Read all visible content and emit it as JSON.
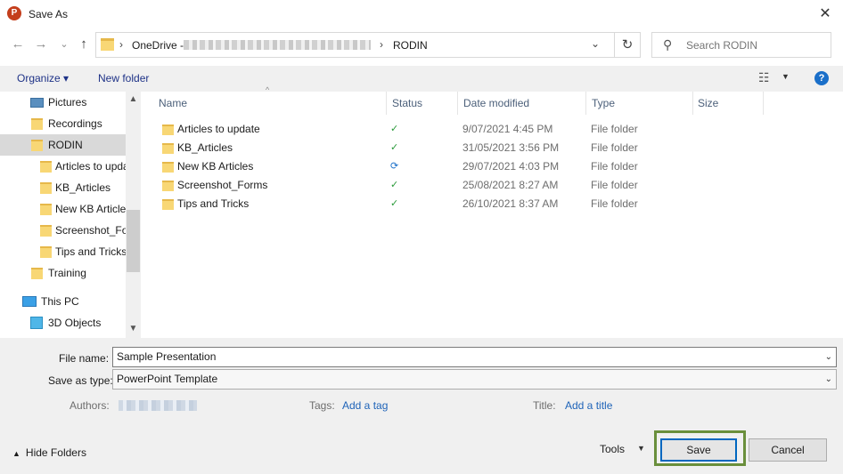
{
  "window": {
    "title": "Save As",
    "app_icon": "P"
  },
  "nav": {
    "back_glyph": "←",
    "forward_glyph": "→",
    "recent_glyph": "⌄",
    "up_glyph": "↑",
    "path": [
      "OneDrive -",
      "RODIN"
    ],
    "refresh_glyph": "↻",
    "search_placeholder": "Search RODIN"
  },
  "toolbar": {
    "organize": "Organize ▾",
    "new_folder": "New folder",
    "help": "?"
  },
  "tree": [
    {
      "label": "Pictures",
      "icon": "pictures-icon",
      "indent": 1
    },
    {
      "label": "Recordings",
      "icon": "folder-icon",
      "indent": 1
    },
    {
      "label": "RODIN",
      "icon": "folder-icon",
      "indent": 1,
      "selected": true
    },
    {
      "label": "Articles to update",
      "icon": "folder-icon",
      "indent": 2
    },
    {
      "label": "KB_Articles",
      "icon": "folder-icon",
      "indent": 2
    },
    {
      "label": "New KB Articles",
      "icon": "folder-icon",
      "indent": 2
    },
    {
      "label": "Screenshot_Forms",
      "icon": "folder-icon",
      "indent": 2
    },
    {
      "label": "Tips and Tricks",
      "icon": "folder-icon",
      "indent": 2
    },
    {
      "label": "Training",
      "icon": "folder-icon",
      "indent": 1
    },
    {
      "label": "This PC",
      "icon": "pc-icon",
      "indent": 0
    },
    {
      "label": "3D Objects",
      "icon": "cube-icon",
      "indent": 1
    }
  ],
  "columns": [
    "Name",
    "Status",
    "Date modified",
    "Type",
    "Size"
  ],
  "files": [
    {
      "name": "Articles to update",
      "status": "synced",
      "date": "9/07/2021 4:45 PM",
      "type": "File folder"
    },
    {
      "name": "KB_Articles",
      "status": "synced",
      "date": "31/05/2021 3:56 PM",
      "type": "File folder"
    },
    {
      "name": "New KB Articles",
      "status": "syncing",
      "date": "29/07/2021 4:03 PM",
      "type": "File folder"
    },
    {
      "name": "Screenshot_Forms",
      "status": "synced",
      "date": "25/08/2021 8:27 AM",
      "type": "File folder"
    },
    {
      "name": "Tips and Tricks",
      "status": "synced",
      "date": "26/10/2021 8:37 AM",
      "type": "File folder"
    }
  ],
  "form": {
    "file_name_label": "File name:",
    "file_name_value": "Sample Presentation",
    "save_type_label": "Save as type:",
    "save_type_value": "PowerPoint Template",
    "authors_label": "Authors:",
    "tags_label": "Tags:",
    "tags_link": "Add a tag",
    "title_label": "Title:",
    "title_link": "Add a title"
  },
  "footer": {
    "hide_folders": "Hide Folders",
    "tools": "Tools",
    "save": "Save",
    "cancel": "Cancel"
  },
  "colors": {
    "accent": "#0067c0",
    "highlight": "#6a8f3c",
    "link": "#1e63b8",
    "sync_ok": "#2a9a3a"
  }
}
